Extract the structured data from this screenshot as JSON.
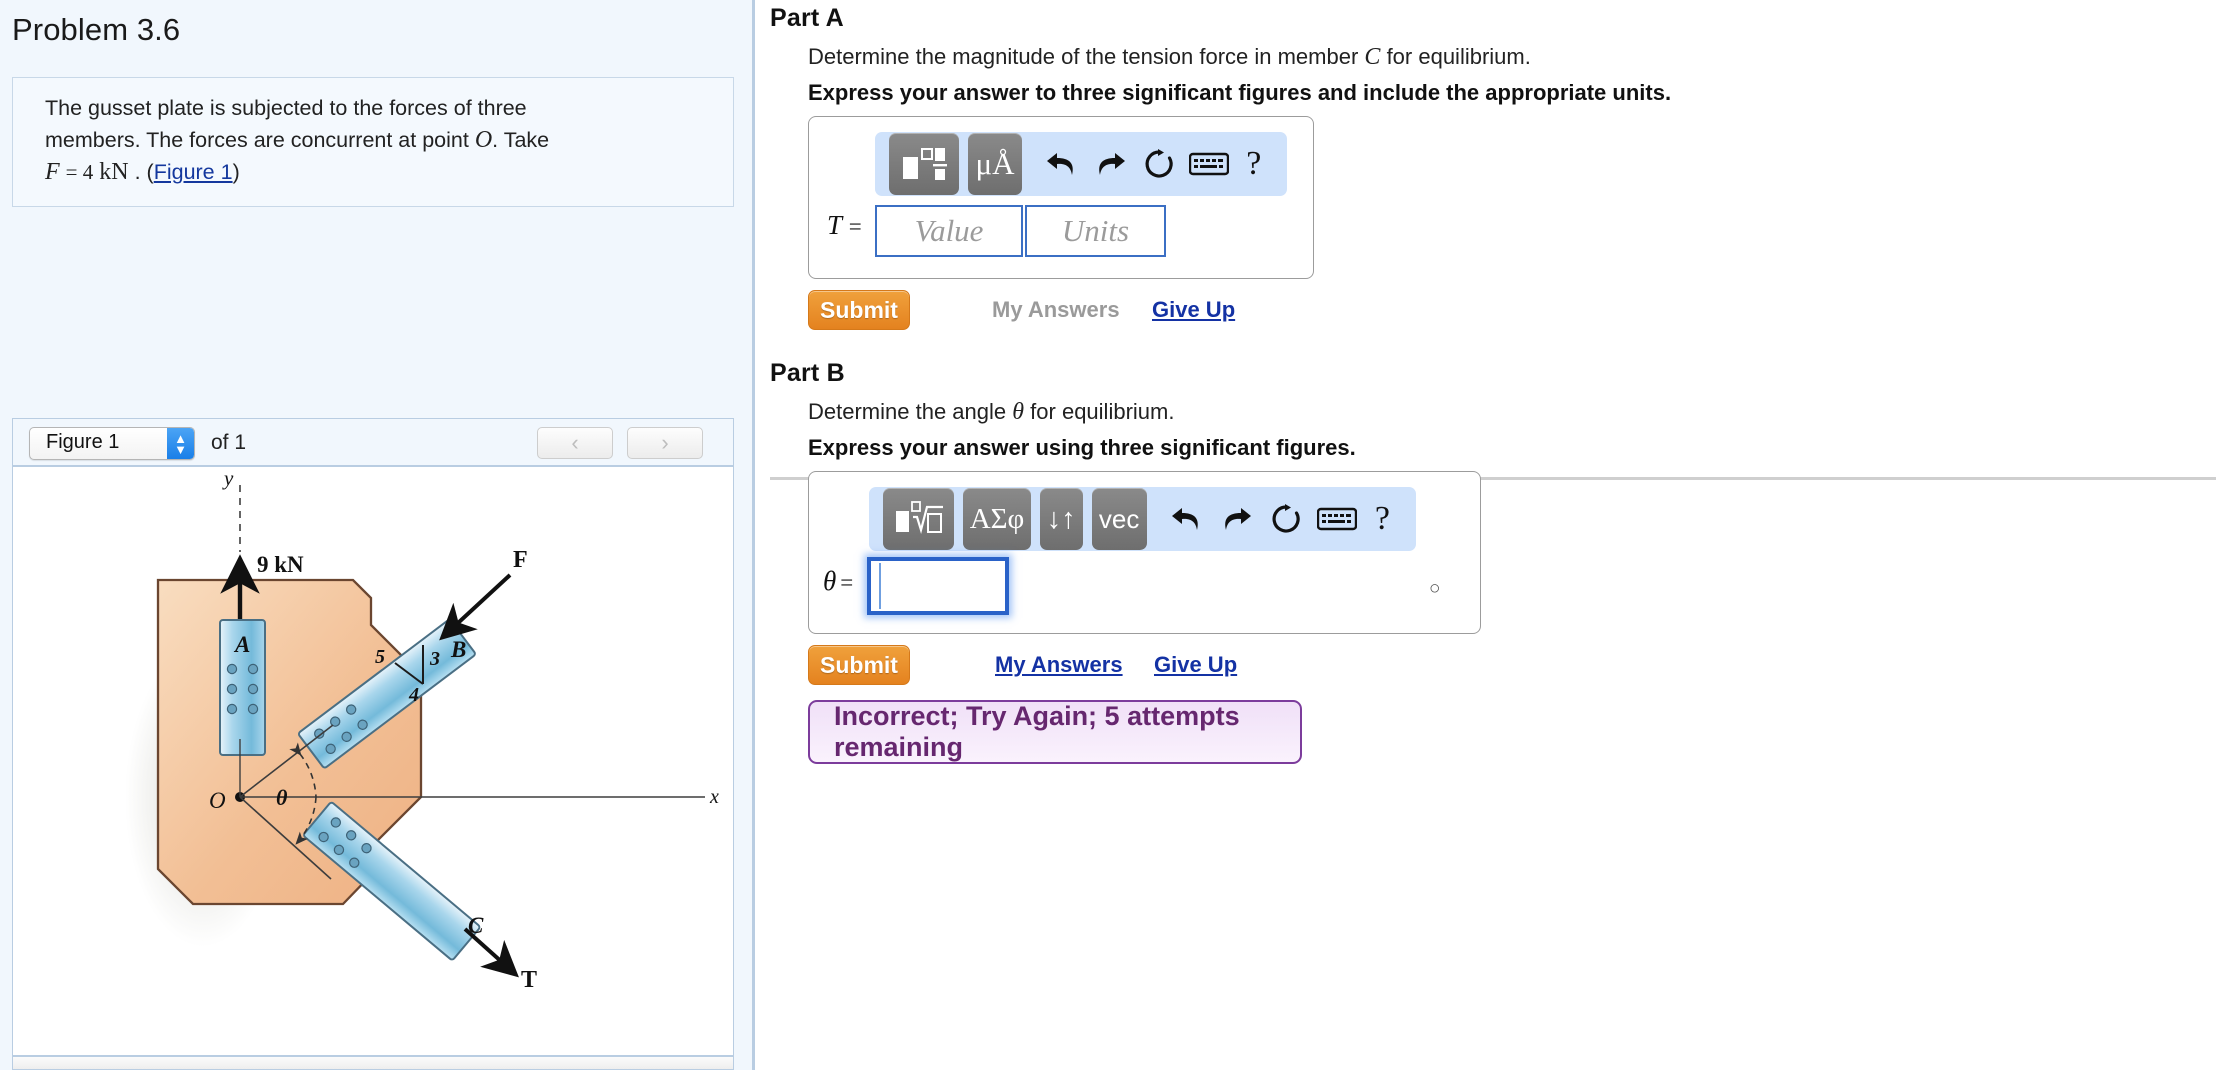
{
  "problem": {
    "title": "Problem 3.6",
    "statement_line1": "The gusset plate is subjected to the forces of three",
    "statement_line2_a": "members. The forces are concurrent at point",
    "statement_line2_O": "O",
    "statement_line2_b": ". Take",
    "statement_F": "F",
    "statement_eq": "= 4",
    "statement_units": "kN",
    "statement_dot": ".",
    "statement_paren_open": "(",
    "figure_link": "Figure 1",
    "statement_paren_close": ")"
  },
  "figure_panel": {
    "select_value": "Figure 1",
    "of_label": "of 1",
    "prev_icon": "chevron-left",
    "next_icon": "chevron-right"
  },
  "figure": {
    "axis_y": "y",
    "axis_x": "x",
    "force_9kn": "9 kN",
    "member_a": "A",
    "member_b": "B",
    "member_c": "C",
    "force_f": "F",
    "force_t": "T",
    "origin": "O",
    "angle": "θ",
    "slope_5": "5",
    "slope_3": "3",
    "slope_4": "4",
    "plate_fill_light": "#f7d9b8",
    "plate_fill_dark": "#eeb183",
    "member_fill_light": "#cfe7f5",
    "member_fill_dark": "#79bcdc"
  },
  "partA": {
    "label": "Part A",
    "prompt_a": "Determine the magnitude of the tension force in member",
    "prompt_var": "C",
    "prompt_b": "for equilibrium.",
    "instruction": "Express your answer to three significant figures and include the appropriate units.",
    "toolbar": [
      {
        "name": "template-icon",
        "label": ""
      },
      {
        "name": "units-icon",
        "label": "μÅ"
      },
      {
        "name": "undo-icon",
        "label": ""
      },
      {
        "name": "redo-icon",
        "label": ""
      },
      {
        "name": "reset-icon",
        "label": ""
      },
      {
        "name": "keyboard-icon",
        "label": ""
      },
      {
        "name": "help-icon",
        "label": "?"
      }
    ],
    "var_label": "T",
    "equals": "=",
    "value_placeholder": "Value",
    "units_placeholder": "Units",
    "value_current": "",
    "units_current": "",
    "submit_label": "Submit",
    "my_answers_label": "My Answers",
    "give_up_label": "Give Up"
  },
  "partB": {
    "label": "Part B",
    "prompt_a": "Determine the angle",
    "prompt_var": "θ",
    "prompt_b": "for equilibrium.",
    "instruction": "Express your answer using three significant figures.",
    "toolbar": [
      {
        "name": "template-radical-icon",
        "label": ""
      },
      {
        "name": "greek-icon",
        "label": "ΑΣφ"
      },
      {
        "name": "subscript-superscript-icon",
        "label": "↓↑"
      },
      {
        "name": "vector-icon",
        "label": "vec"
      },
      {
        "name": "undo-icon",
        "label": ""
      },
      {
        "name": "redo-icon",
        "label": ""
      },
      {
        "name": "reset-icon",
        "label": ""
      },
      {
        "name": "keyboard-icon",
        "label": ""
      },
      {
        "name": "help-icon",
        "label": "?"
      }
    ],
    "var_label": "θ",
    "equals": "=",
    "answer_value": "",
    "unit_suffix": "○",
    "submit_label": "Submit",
    "my_answers_label": "My Answers",
    "give_up_label": "Give Up",
    "feedback": "Incorrect; Try Again; 5 attempts remaining"
  },
  "colors": {
    "panel_bg": "#f1f7fd",
    "accent_orange": "#e4821f",
    "link_blue": "#1432a4",
    "toolbar_blue": "#cfe2fb",
    "feedback_purple": "#66276f"
  }
}
